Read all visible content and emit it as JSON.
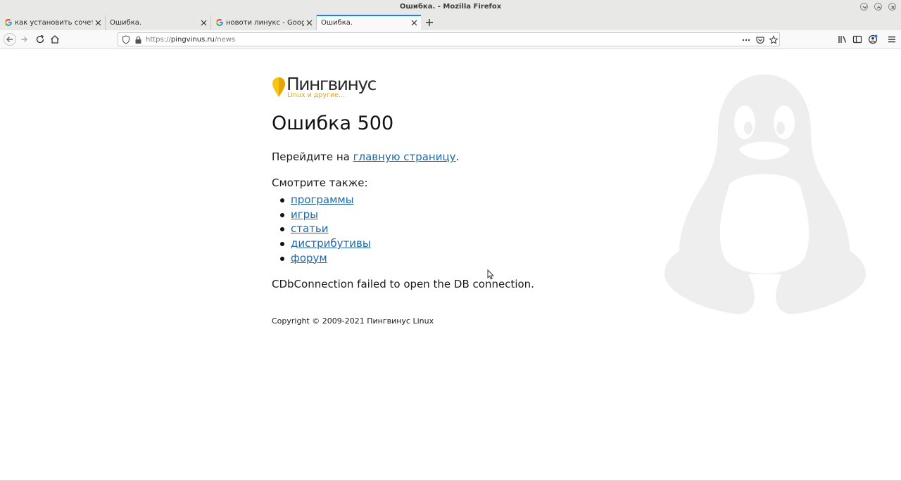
{
  "window": {
    "title": "Ошибка. - Mozilla Firefox"
  },
  "tabs": [
    {
      "label": "как установить сочетание",
      "favicon": "google-g-icon",
      "active": false
    },
    {
      "label": "Ошибка.",
      "favicon": "none",
      "active": false
    },
    {
      "label": "новоти линукс - Google",
      "favicon": "google-g-icon",
      "active": false
    },
    {
      "label": "Ошибка.",
      "favicon": "none",
      "active": true
    }
  ],
  "urlbar": {
    "protocol": "https://",
    "host": "pingvinus.ru",
    "path": "/news"
  },
  "page": {
    "logo_name": "Пингвинус",
    "logo_tagline": "Linux и другие...",
    "heading": "Ошибка 500",
    "go_prefix": "Перейдите на ",
    "go_link": "главную страницу",
    "go_suffix": ".",
    "see_also": "Смотрите также:",
    "links": [
      "программы",
      "игры",
      "статьи",
      "дистрибутивы",
      "форум"
    ],
    "error_message": "CDbConnection failed to open the DB connection.",
    "copyright": "Copyright © 2009-2021 Пингвинус Linux"
  },
  "colors": {
    "accent": "#0a84ff",
    "link": "#2169a6",
    "logo_yellow": "#f5c518",
    "tux_watermark": "#eeeeee"
  }
}
